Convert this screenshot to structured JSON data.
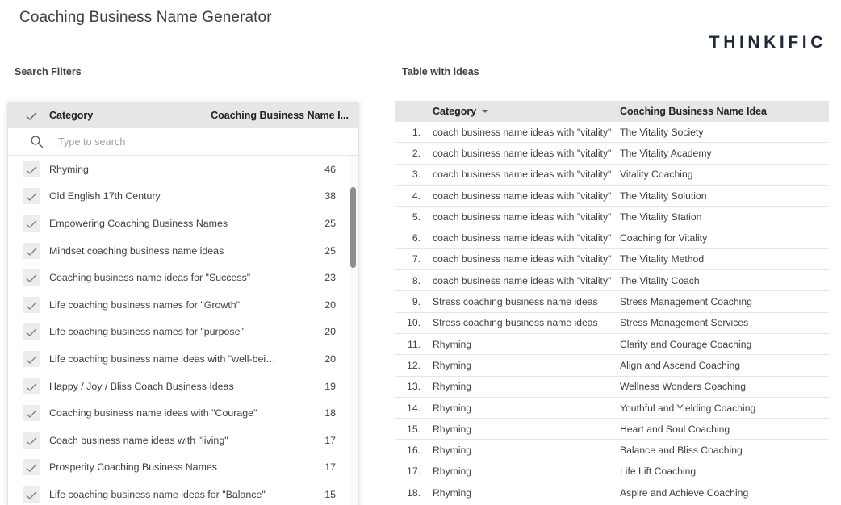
{
  "header": {
    "title": "Coaching Business Name Generator",
    "brand": "THINKIFIC"
  },
  "captions": {
    "filters": "Search Filters",
    "table": "Table with ideas"
  },
  "filter_panel": {
    "header": {
      "check_icon": "checkmark-icon",
      "label": "Category",
      "right_label": "Coaching Business Name I..."
    },
    "search": {
      "icon": "search-icon",
      "placeholder": "Type to search",
      "value": ""
    },
    "items": [
      {
        "label": "Rhyming",
        "count": "46",
        "checked": true
      },
      {
        "label": "Old English 17th Century",
        "count": "38",
        "checked": true
      },
      {
        "label": "Empowering Coaching Business Names",
        "count": "25",
        "checked": true
      },
      {
        "label": "Mindset coaching business name ideas",
        "count": "25",
        "checked": true
      },
      {
        "label": "Coaching business name ideas for \"Success\"",
        "count": "23",
        "checked": true
      },
      {
        "label": "Life coaching business names for \"Growth\"",
        "count": "20",
        "checked": true
      },
      {
        "label": "Life coaching business names for \"purpose\"",
        "count": "20",
        "checked": true
      },
      {
        "label": "Life coaching business name ideas with \"well-bei…",
        "count": "20",
        "checked": true
      },
      {
        "label": "Happy / Joy / Bliss Coach Business Ideas",
        "count": "19",
        "checked": true
      },
      {
        "label": "Coaching business name ideas with \"Courage\"",
        "count": "18",
        "checked": true
      },
      {
        "label": "Coach business name ideas with \"living\"",
        "count": "17",
        "checked": true
      },
      {
        "label": "Prosperity Coaching Business Names",
        "count": "17",
        "checked": true
      },
      {
        "label": "Life coaching business name ideas for \"Balance\"",
        "count": "15",
        "checked": true
      }
    ],
    "scrollbar": {
      "thumb_top_pct": 9,
      "thumb_height_pct": 23
    }
  },
  "ideas_table": {
    "columns": {
      "number": "",
      "category": "Category",
      "idea": "Coaching Business Name Idea"
    },
    "sort_icon": "sort-descending-caret-icon",
    "rows": [
      {
        "num": "1.",
        "category": "coach business name ideas with \"vitality\"",
        "idea": "The Vitality Society"
      },
      {
        "num": "2.",
        "category": "coach business name ideas with \"vitality\"",
        "idea": "The Vitality Academy"
      },
      {
        "num": "3.",
        "category": "coach business name ideas with \"vitality\"",
        "idea": "Vitality Coaching"
      },
      {
        "num": "4.",
        "category": "coach business name ideas with \"vitality\"",
        "idea": "The Vitality Solution"
      },
      {
        "num": "5.",
        "category": "coach business name ideas with \"vitality\"",
        "idea": "The Vitality Station"
      },
      {
        "num": "6.",
        "category": "coach business name ideas with \"vitality\"",
        "idea": "Coaching for Vitality"
      },
      {
        "num": "7.",
        "category": "coach business name ideas with \"vitality\"",
        "idea": "The Vitality Method"
      },
      {
        "num": "8.",
        "category": "coach business name ideas with \"vitality\"",
        "idea": "The Vitality Coach"
      },
      {
        "num": "9.",
        "category": "Stress coaching business name ideas",
        "idea": "Stress Management Coaching"
      },
      {
        "num": "10.",
        "category": "Stress coaching business name ideas",
        "idea": "Stress Management Services"
      },
      {
        "num": "11.",
        "category": "Rhyming",
        "idea": "Clarity and Courage Coaching"
      },
      {
        "num": "12.",
        "category": "Rhyming",
        "idea": "Align and Ascend Coaching"
      },
      {
        "num": "13.",
        "category": "Rhyming",
        "idea": "Wellness Wonders Coaching"
      },
      {
        "num": "14.",
        "category": "Rhyming",
        "idea": "Youthful and Yielding Coaching"
      },
      {
        "num": "15.",
        "category": "Rhyming",
        "idea": "Heart and Soul Coaching"
      },
      {
        "num": "16.",
        "category": "Rhyming",
        "idea": "Balance and Bliss Coaching"
      },
      {
        "num": "17.",
        "category": "Rhyming",
        "idea": "Life Lift Coaching"
      },
      {
        "num": "18.",
        "category": "Rhyming",
        "idea": "Aspire and Achieve Coaching"
      }
    ]
  },
  "colors": {
    "header_gray": "#e6e6e6",
    "text": "#3c4043",
    "brand_navy": "#20293a",
    "placeholder": "#9aa0a6",
    "checkbox_fill": "#ededed"
  }
}
